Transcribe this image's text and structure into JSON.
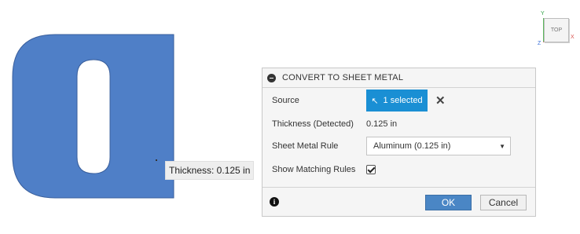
{
  "viewport": {
    "tooltip_text": "Thickness: 0.125 in",
    "part_color": "#4f7fc7",
    "viewcube": {
      "face_label": "TOP",
      "axis_x": "X",
      "axis_y": "Y",
      "axis_z": "Z"
    }
  },
  "dialog": {
    "title": "CONVERT TO SHEET METAL",
    "source": {
      "label": "Source",
      "button_label": "1 selected",
      "accent": "#1a8fd4"
    },
    "thickness": {
      "label": "Thickness (Detected)",
      "value": "0.125 in"
    },
    "rule": {
      "label": "Sheet Metal Rule",
      "selected": "Aluminum (0.125 in)"
    },
    "matching": {
      "label": "Show Matching Rules",
      "checked": true
    },
    "ok_label": "OK",
    "cancel_label": "Cancel"
  }
}
